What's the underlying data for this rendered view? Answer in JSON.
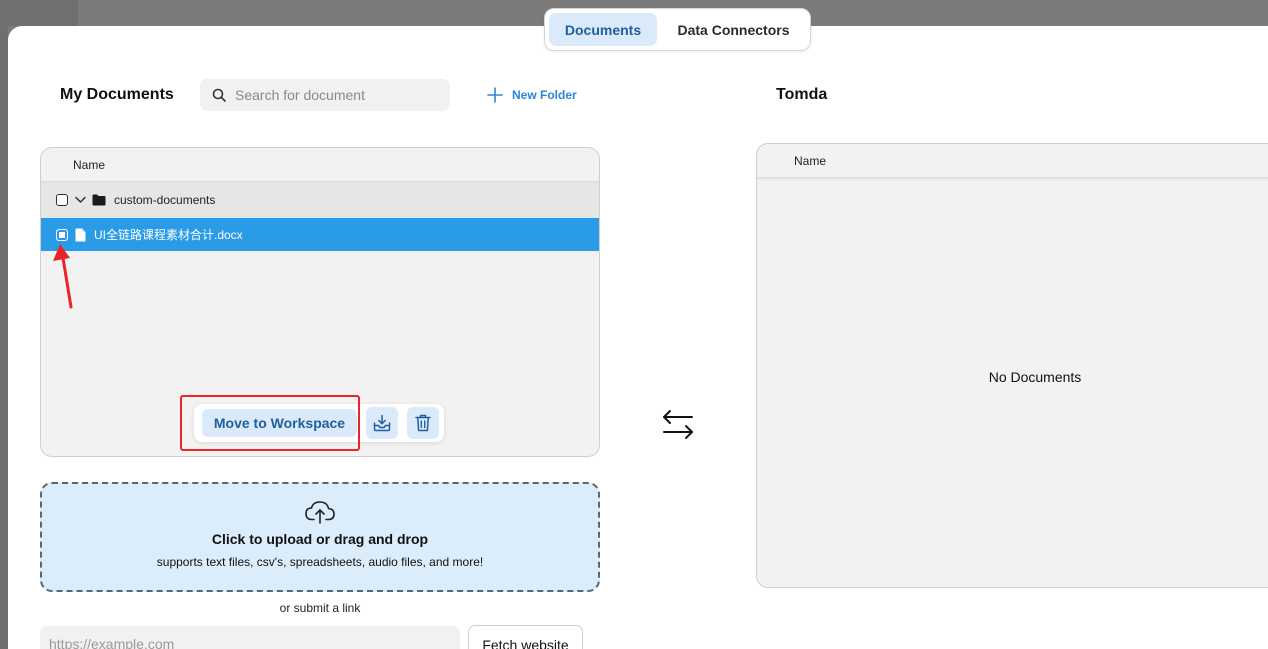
{
  "tabs": [
    {
      "label": "Documents",
      "active": true
    },
    {
      "label": "Data Connectors",
      "active": false
    }
  ],
  "left": {
    "title": "My Documents",
    "search_placeholder": "Search for document",
    "new_folder_label": "New Folder",
    "table_header": "Name",
    "folder": {
      "name": "custom-documents",
      "expanded": true
    },
    "file": {
      "name": "UI全链路课程素材合计.docx",
      "selected": true
    },
    "actions": {
      "move_label": "Move to Workspace",
      "download_icon": "download-tray-icon",
      "delete_icon": "trash-icon"
    }
  },
  "upload": {
    "main_text": "Click to upload or drag and drop",
    "sub_text": "supports text files, csv's, spreadsheets, audio files, and more!",
    "or_link_text": "or submit a link",
    "link_placeholder": "https://example.com",
    "fetch_label": "Fetch website"
  },
  "workspace": {
    "title": "Tomda",
    "table_header": "Name",
    "empty_text": "No Documents"
  },
  "colors": {
    "accent": "#2a9be6",
    "accent_soft": "#dbeafb",
    "highlight": "#e8262a"
  }
}
